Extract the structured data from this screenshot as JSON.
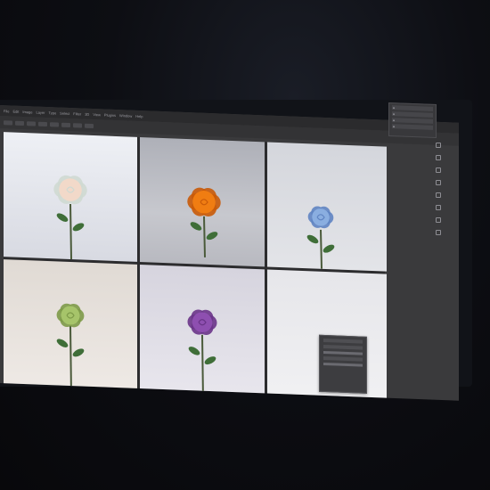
{
  "app": {
    "menus": [
      "File",
      "Edit",
      "Image",
      "Layer",
      "Type",
      "Select",
      "Filter",
      "3D",
      "View",
      "Plugins",
      "Window",
      "Help"
    ],
    "share_label": ""
  },
  "canvas": {
    "tiles": [
      {
        "id": "rose-white",
        "rose_color": "#f2d9c9",
        "petal_shadow": "#cfd9d2"
      },
      {
        "id": "rose-orange",
        "rose_color": "#f07d12",
        "petal_shadow": "#c95a08"
      },
      {
        "id": "rose-blue",
        "rose_color": "#8aaee0",
        "petal_shadow": "#5f84c2"
      },
      {
        "id": "rose-green",
        "rose_color": "#a6c46a",
        "petal_shadow": "#7d9a48"
      },
      {
        "id": "rose-purple",
        "rose_color": "#8e4fb0",
        "petal_shadow": "#6a3488"
      },
      {
        "id": "blank",
        "rose_color": "",
        "petal_shadow": ""
      }
    ],
    "stem_color": "#4a5a3a",
    "leaf_color": "#3f6e38"
  },
  "colors": {
    "accent": "#2f7fe6",
    "ui_dark": "#2b2b2d",
    "ui_mid": "#3a3a3c"
  },
  "icons": [
    "move-tool-icon",
    "marquee-tool-icon",
    "lasso-tool-icon",
    "crop-tool-icon",
    "brush-tool-icon",
    "eraser-tool-icon",
    "type-tool-icon",
    "zoom-tool-icon"
  ]
}
